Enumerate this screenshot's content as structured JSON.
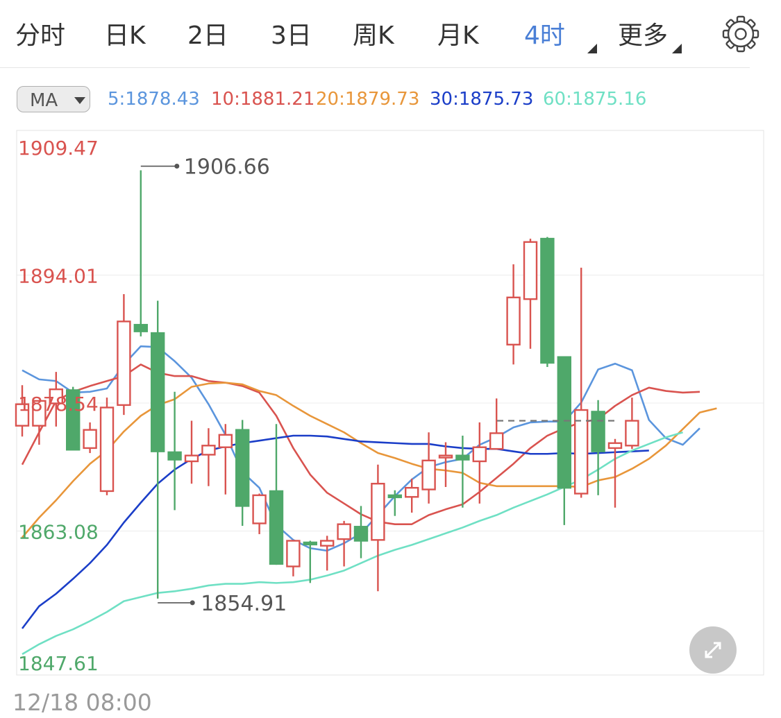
{
  "tabs": [
    {
      "label": "分时",
      "active": false
    },
    {
      "label": "日K",
      "active": false
    },
    {
      "label": "2日",
      "active": false
    },
    {
      "label": "3日",
      "active": false
    },
    {
      "label": "周K",
      "active": false
    },
    {
      "label": "月K",
      "active": false
    },
    {
      "label": "4时",
      "active": true
    },
    {
      "label": "更多",
      "active": false
    }
  ],
  "indicator": {
    "selected": "MA",
    "items": [
      {
        "label": "5:1878.43",
        "color": "#5b95dd"
      },
      {
        "label": "10:1881.21",
        "color": "#d9534f"
      },
      {
        "label": "20:1879.73",
        "color": "#e8963a"
      },
      {
        "label": "30:1875.73",
        "color": "#1b3ec8"
      },
      {
        "label": "60:1875.16",
        "color": "#6fe0c4"
      }
    ]
  },
  "footer": {
    "start_time": "12/18 08:00"
  },
  "colors": {
    "up": "#d9534f",
    "down": "#4fa86a",
    "accent": "#4a7fd6"
  },
  "chart_data": {
    "type": "candlestick",
    "ylim": [
      1847.61,
      1909.47
    ],
    "y_ticks": [
      "1909.47",
      "1894.01",
      "1878.54",
      "1863.08",
      "1847.61"
    ],
    "high_label": "1906.66",
    "low_label": "1854.91",
    "last_price": 1876.4,
    "candles": [
      {
        "o": 1875.8,
        "h": 1880.7,
        "l": 1874.5,
        "c": 1878.4
      },
      {
        "o": 1875.8,
        "h": 1878.8,
        "l": 1873.5,
        "c": 1878.8
      },
      {
        "o": 1878.5,
        "h": 1882.3,
        "l": 1875.7,
        "c": 1880.2
      },
      {
        "o": 1880.1,
        "h": 1880.5,
        "l": 1872.9,
        "c": 1872.9
      },
      {
        "o": 1873.1,
        "h": 1876.2,
        "l": 1872.5,
        "c": 1875.3
      },
      {
        "o": 1867.9,
        "h": 1879.2,
        "l": 1867.4,
        "c": 1878.0
      },
      {
        "o": 1878.3,
        "h": 1891.7,
        "l": 1877.1,
        "c": 1888.4
      },
      {
        "o": 1888.0,
        "h": 1906.66,
        "l": 1886.6,
        "c": 1887.2
      },
      {
        "o": 1887.0,
        "h": 1890.9,
        "l": 1854.91,
        "c": 1872.7
      },
      {
        "o": 1872.6,
        "h": 1879.9,
        "l": 1865.6,
        "c": 1871.7
      },
      {
        "o": 1871.5,
        "h": 1876.4,
        "l": 1868.8,
        "c": 1872.2
      },
      {
        "o": 1872.3,
        "h": 1875.5,
        "l": 1868.5,
        "c": 1873.4
      },
      {
        "o": 1873.2,
        "h": 1876.0,
        "l": 1867.5,
        "c": 1874.7
      },
      {
        "o": 1875.3,
        "h": 1876.5,
        "l": 1863.7,
        "c": 1866.1
      },
      {
        "o": 1864.0,
        "h": 1867.6,
        "l": 1862.7,
        "c": 1867.4
      },
      {
        "o": 1867.9,
        "h": 1876.0,
        "l": 1859.0,
        "c": 1859.1
      },
      {
        "o": 1858.8,
        "h": 1862.0,
        "l": 1857.6,
        "c": 1861.9
      },
      {
        "o": 1861.7,
        "h": 1861.9,
        "l": 1856.8,
        "c": 1861.5
      },
      {
        "o": 1861.3,
        "h": 1862.5,
        "l": 1858.3,
        "c": 1861.9
      },
      {
        "o": 1862.1,
        "h": 1864.3,
        "l": 1858.8,
        "c": 1863.9
      },
      {
        "o": 1863.6,
        "h": 1866.1,
        "l": 1859.8,
        "c": 1861.9
      },
      {
        "o": 1862.0,
        "h": 1871.1,
        "l": 1855.8,
        "c": 1868.8
      },
      {
        "o": 1867.4,
        "h": 1868.0,
        "l": 1864.9,
        "c": 1867.2
      },
      {
        "o": 1867.2,
        "h": 1869.4,
        "l": 1865.3,
        "c": 1868.3
      },
      {
        "o": 1868.1,
        "h": 1875.0,
        "l": 1866.4,
        "c": 1871.6
      },
      {
        "o": 1872.0,
        "h": 1873.8,
        "l": 1868.4,
        "c": 1872.2
      },
      {
        "o": 1872.2,
        "h": 1874.6,
        "l": 1865.9,
        "c": 1871.7
      },
      {
        "o": 1871.5,
        "h": 1876.2,
        "l": 1866.4,
        "c": 1873.2
      },
      {
        "o": 1873.0,
        "h": 1879.1,
        "l": 1872.9,
        "c": 1874.9
      },
      {
        "o": 1885.6,
        "h": 1895.3,
        "l": 1883.2,
        "c": 1891.3
      },
      {
        "o": 1891.1,
        "h": 1898.4,
        "l": 1885.1,
        "c": 1898.0
      },
      {
        "o": 1898.4,
        "h": 1898.6,
        "l": 1882.9,
        "c": 1883.4
      },
      {
        "o": 1884.1,
        "h": 1884.2,
        "l": 1863.8,
        "c": 1868.3
      },
      {
        "o": 1867.6,
        "h": 1894.9,
        "l": 1867.1,
        "c": 1877.7
      },
      {
        "o": 1877.5,
        "h": 1878.9,
        "l": 1867.4,
        "c": 1872.7
      },
      {
        "o": 1873.1,
        "h": 1874.2,
        "l": 1865.9,
        "c": 1873.7
      },
      {
        "o": 1873.4,
        "h": 1879.2,
        "l": 1873.0,
        "c": 1876.4
      }
    ],
    "series": [
      {
        "name": "5",
        "color": "#5b95dd",
        "points": [
          [
            0,
            1882.5
          ],
          [
            1,
            1881.4
          ],
          [
            2,
            1881.2
          ],
          [
            3,
            1879.8
          ],
          [
            4,
            1879.9
          ],
          [
            5,
            1880.3
          ],
          [
            6,
            1883.2
          ],
          [
            7,
            1885.4
          ],
          [
            8,
            1885.3
          ],
          [
            9,
            1883.6
          ],
          [
            10,
            1881.6
          ],
          [
            11,
            1878.4
          ],
          [
            12,
            1874.7
          ],
          [
            13,
            1870.2
          ],
          [
            14,
            1868.3
          ],
          [
            15,
            1863.8
          ],
          [
            16,
            1862.0
          ],
          [
            17,
            1861.0
          ],
          [
            18,
            1860.7
          ],
          [
            19,
            1861.6
          ],
          [
            20,
            1862.8
          ],
          [
            21,
            1865.0
          ],
          [
            22,
            1867.3
          ],
          [
            23,
            1869.3
          ],
          [
            24,
            1870.8
          ],
          [
            25,
            1871.4
          ],
          [
            26,
            1871.8
          ],
          [
            27,
            1873.5
          ],
          [
            28,
            1874.4
          ],
          [
            29,
            1875.6
          ],
          [
            30,
            1876.2
          ],
          [
            31,
            1876.3
          ],
          [
            32,
            1876.3
          ],
          [
            33,
            1878.6
          ],
          [
            34,
            1882.6
          ],
          [
            35,
            1883.3
          ],
          [
            36,
            1882.5
          ],
          [
            37,
            1876.5
          ],
          [
            38,
            1874.3
          ],
          [
            39,
            1873.5
          ],
          [
            40,
            1875.5
          ]
        ]
      },
      {
        "name": "10",
        "color": "#d9534f",
        "points": [
          [
            0,
            1871.1
          ],
          [
            1,
            1875.0
          ],
          [
            2,
            1878.8
          ],
          [
            3,
            1879.9
          ],
          [
            4,
            1880.6
          ],
          [
            5,
            1881.2
          ],
          [
            6,
            1881.8
          ],
          [
            7,
            1883.2
          ],
          [
            8,
            1882.2
          ],
          [
            9,
            1881.8
          ],
          [
            10,
            1881.8
          ],
          [
            11,
            1881.2
          ],
          [
            12,
            1881.0
          ],
          [
            13,
            1880.6
          ],
          [
            14,
            1879.8
          ],
          [
            15,
            1877.0
          ],
          [
            16,
            1873.1
          ],
          [
            17,
            1869.9
          ],
          [
            18,
            1867.7
          ],
          [
            19,
            1866.4
          ],
          [
            20,
            1865.1
          ],
          [
            21,
            1864.2
          ],
          [
            22,
            1863.9
          ],
          [
            23,
            1863.9
          ],
          [
            24,
            1865.0
          ],
          [
            25,
            1865.7
          ],
          [
            26,
            1866.3
          ],
          [
            27,
            1867.8
          ],
          [
            28,
            1869.5
          ],
          [
            29,
            1871.2
          ],
          [
            30,
            1873.1
          ],
          [
            31,
            1874.6
          ],
          [
            32,
            1875.5
          ],
          [
            33,
            1876.2
          ],
          [
            34,
            1876.6
          ],
          [
            35,
            1878.2
          ],
          [
            36,
            1879.5
          ],
          [
            37,
            1880.4
          ],
          [
            38,
            1880.0
          ],
          [
            39,
            1879.8
          ],
          [
            40,
            1879.9
          ]
        ]
      },
      {
        "name": "20",
        "color": "#e8963a",
        "points": [
          [
            0,
            1862.3
          ],
          [
            1,
            1864.7
          ],
          [
            2,
            1866.8
          ],
          [
            3,
            1869.1
          ],
          [
            4,
            1871.2
          ],
          [
            5,
            1872.8
          ],
          [
            6,
            1875.1
          ],
          [
            7,
            1877.0
          ],
          [
            8,
            1878.3
          ],
          [
            9,
            1879.0
          ],
          [
            10,
            1880.5
          ],
          [
            11,
            1880.9
          ],
          [
            12,
            1881.0
          ],
          [
            13,
            1880.8
          ],
          [
            14,
            1880.0
          ],
          [
            15,
            1879.5
          ],
          [
            16,
            1878.2
          ],
          [
            17,
            1877.0
          ],
          [
            18,
            1876.0
          ],
          [
            19,
            1875.0
          ],
          [
            20,
            1873.7
          ],
          [
            21,
            1872.5
          ],
          [
            22,
            1871.9
          ],
          [
            23,
            1871.2
          ],
          [
            24,
            1870.6
          ],
          [
            25,
            1870.4
          ],
          [
            26,
            1870.1
          ],
          [
            27,
            1868.9
          ],
          [
            28,
            1868.5
          ],
          [
            29,
            1868.5
          ],
          [
            30,
            1868.5
          ],
          [
            31,
            1868.5
          ],
          [
            32,
            1868.5
          ],
          [
            33,
            1868.4
          ],
          [
            34,
            1869.2
          ],
          [
            35,
            1869.6
          ],
          [
            36,
            1870.6
          ],
          [
            37,
            1871.8
          ],
          [
            38,
            1873.4
          ],
          [
            39,
            1875.4
          ],
          [
            40,
            1877.4
          ],
          [
            41,
            1877.9
          ]
        ]
      },
      {
        "name": "30",
        "color": "#1b3ec8",
        "points": [
          [
            0,
            1851.3
          ],
          [
            1,
            1854.0
          ],
          [
            2,
            1855.5
          ],
          [
            3,
            1857.3
          ],
          [
            4,
            1859.2
          ],
          [
            5,
            1861.4
          ],
          [
            6,
            1864.1
          ],
          [
            7,
            1866.5
          ],
          [
            8,
            1868.8
          ],
          [
            9,
            1870.5
          ],
          [
            10,
            1871.8
          ],
          [
            11,
            1872.8
          ],
          [
            12,
            1873.3
          ],
          [
            13,
            1873.7
          ],
          [
            14,
            1874.0
          ],
          [
            15,
            1874.3
          ],
          [
            16,
            1874.6
          ],
          [
            17,
            1874.6
          ],
          [
            18,
            1874.5
          ],
          [
            19,
            1874.2
          ],
          [
            20,
            1873.9
          ],
          [
            21,
            1873.8
          ],
          [
            22,
            1873.7
          ],
          [
            23,
            1873.6
          ],
          [
            24,
            1873.6
          ],
          [
            25,
            1873.3
          ],
          [
            26,
            1873.1
          ],
          [
            27,
            1873.0
          ],
          [
            28,
            1873.0
          ],
          [
            29,
            1872.7
          ],
          [
            30,
            1872.4
          ],
          [
            31,
            1872.4
          ],
          [
            32,
            1872.5
          ],
          [
            33,
            1872.4
          ],
          [
            34,
            1872.5
          ],
          [
            35,
            1872.6
          ],
          [
            36,
            1872.7
          ],
          [
            37,
            1872.8
          ]
        ]
      },
      {
        "name": "60",
        "color": "#6fe0c4",
        "points": [
          [
            0,
            1848.2
          ],
          [
            1,
            1849.4
          ],
          [
            2,
            1850.4
          ],
          [
            3,
            1851.2
          ],
          [
            4,
            1852.2
          ],
          [
            5,
            1853.3
          ],
          [
            6,
            1854.6
          ],
          [
            7,
            1855.1
          ],
          [
            8,
            1855.6
          ],
          [
            9,
            1855.8
          ],
          [
            10,
            1856.1
          ],
          [
            11,
            1856.5
          ],
          [
            12,
            1856.7
          ],
          [
            13,
            1856.7
          ],
          [
            14,
            1856.9
          ],
          [
            15,
            1856.8
          ],
          [
            16,
            1856.9
          ],
          [
            17,
            1857.2
          ],
          [
            18,
            1857.7
          ],
          [
            19,
            1858.3
          ],
          [
            20,
            1859.2
          ],
          [
            21,
            1860.1
          ],
          [
            22,
            1860.8
          ],
          [
            23,
            1861.4
          ],
          [
            24,
            1862.1
          ],
          [
            25,
            1862.8
          ],
          [
            26,
            1863.5
          ],
          [
            27,
            1864.3
          ],
          [
            28,
            1865.0
          ],
          [
            29,
            1865.9
          ],
          [
            30,
            1866.7
          ],
          [
            31,
            1867.5
          ],
          [
            32,
            1868.4
          ],
          [
            33,
            1869.3
          ],
          [
            34,
            1870.5
          ],
          [
            35,
            1871.8
          ],
          [
            36,
            1872.8
          ],
          [
            37,
            1873.6
          ],
          [
            38,
            1874.4
          ],
          [
            39,
            1875.0
          ]
        ]
      }
    ]
  }
}
